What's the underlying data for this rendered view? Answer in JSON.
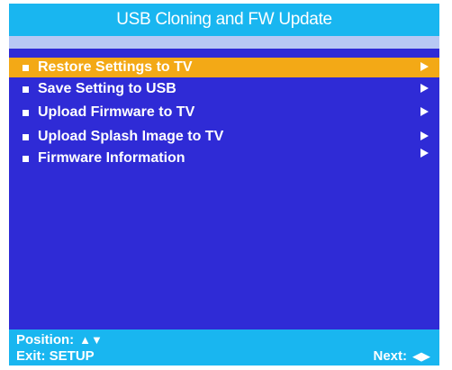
{
  "title": "USB Cloning and FW Update",
  "menu": {
    "items": [
      {
        "label": "Restore Settings to TV",
        "selected": true
      },
      {
        "label": "Save Setting to USB",
        "selected": false
      },
      {
        "label": "Upload Firmware to TV",
        "selected": false
      },
      {
        "label": "Upload Splash Image to TV",
        "selected": false
      },
      {
        "label": "Firmware Information",
        "selected": false
      }
    ]
  },
  "footer": {
    "position_label": "Position:",
    "position_glyphs": "▲▼",
    "exit_label": "Exit: SETUP",
    "next_label": "Next:",
    "next_glyphs": "◀▶"
  },
  "colors": {
    "background": "#2f2bd6",
    "title_bar": "#19b6f0",
    "selection": "#f3a916",
    "text": "#ffffff"
  }
}
